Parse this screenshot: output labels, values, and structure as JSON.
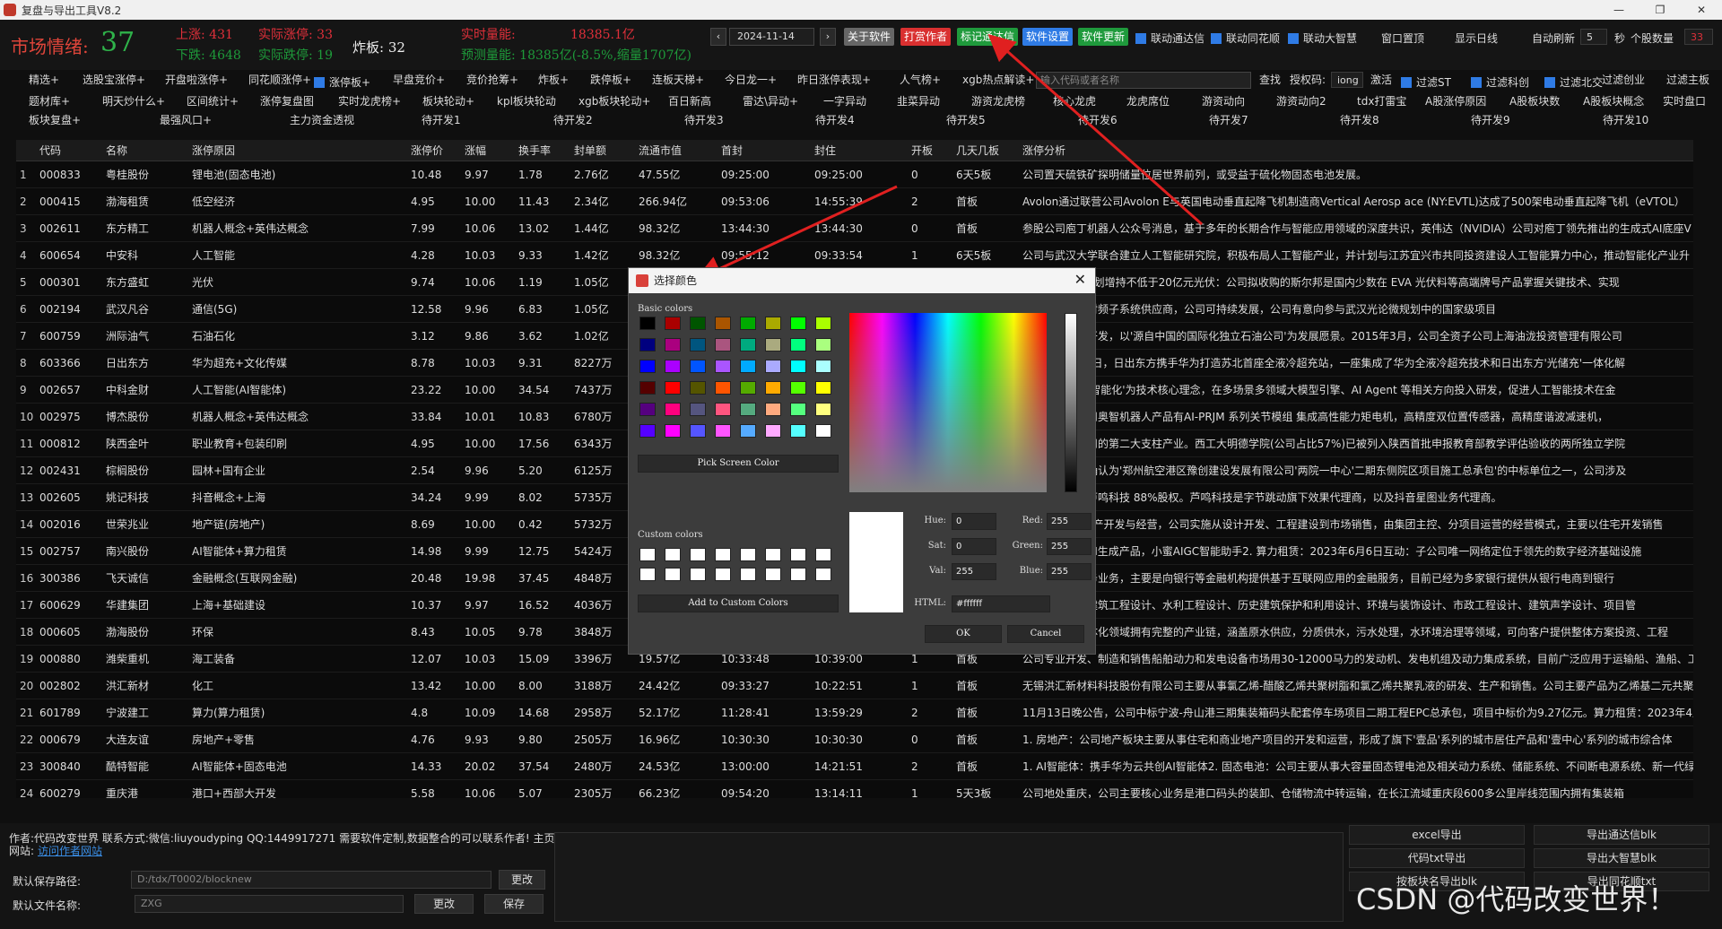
{
  "window": {
    "title": "复盘与导出工具V8.2",
    "controls": [
      "—",
      "❐",
      "✕"
    ]
  },
  "header": {
    "mood_label": "市场情绪:",
    "mood_value": "37",
    "up_limit": "上涨: 431",
    "actual_up_limit": "实际涨停: 33",
    "down_limit": "下跌: 4648",
    "actual_down_limit": "实际跌停: 19",
    "broken": "炸板: 32",
    "realtime_volume_label": "实时量能:",
    "realtime_volume_value": "18385.1亿",
    "forecast_volume": "预测量能: 18385亿(-8.5%,缩量1707亿)",
    "date_prev": "‹",
    "date": "2024-11-14",
    "date_next": "›",
    "buttons": {
      "about": "关于软件",
      "reward": "打赏作者",
      "mark_tdx": "标记通达信",
      "settings": "软件设置",
      "update": "软件更新"
    },
    "link_tdx": "联动通达信",
    "link_ths": "联动同花顺",
    "link_dzh": "联动大智慧",
    "window_top": "窗口置顶",
    "show_sun_line": "显示日线",
    "auto_refresh": "自动刷新",
    "auto_refresh_value": "5",
    "seconds": "秒",
    "stock_count_label": "个股数量",
    "stock_count": "33"
  },
  "tag_rows": {
    "row1": [
      "精选+",
      "选股宝涨停+",
      "开盘啦涨停+",
      "同花顺涨停+",
      "涨停板+",
      "早盘竞价+",
      "竞价抢筹+",
      "炸板+",
      "跌停板+",
      "连板天梯+",
      "今日龙一+",
      "昨日涨停表现+",
      "人气榜+",
      "xgb热点解读+"
    ],
    "search_placeholder": "输入代码或者名称",
    "row1_right": [
      "查找",
      "授权码:",
      "iong",
      "激活",
      "过滤ST",
      "过滤科创",
      "过滤北交",
      "过滤创业",
      "过滤主板"
    ],
    "row2": [
      "题材库+",
      "明天炒什么+",
      "区间统计+",
      "涨停复盘图",
      "实时龙虎榜+",
      "板块轮动+",
      "kpl板块轮动",
      "xgb板块轮动+",
      "百日新高",
      "雷达\\异动+",
      "一字异动",
      "韭菜异动",
      "游资龙虎榜",
      "核心龙虎",
      "龙虎席位",
      "游资动向",
      "游资动向2",
      "tdx打雷宝",
      "A股涨停原因",
      "A股板块数",
      "A股板块概念",
      "实时盘口"
    ],
    "row3": [
      "板块复盘+",
      "最强风口+",
      "主力资金透视",
      "待开发1",
      "待开发2",
      "待开发3",
      "待开发4",
      "待开发5",
      "待开发6",
      "待开发7",
      "待开发8",
      "待开发9",
      "待开发10"
    ]
  },
  "table": {
    "columns": [
      "代码",
      "名称",
      "涨停原因",
      "涨停价",
      "涨幅",
      "换手率",
      "封单额",
      "流通市值",
      "首封",
      "封住",
      "开板",
      "几天几板",
      "涨停分析"
    ],
    "rows": [
      [
        "1",
        "000833",
        "粤桂股份",
        "锂电池(固态电池)",
        "10.48",
        "9.97",
        "1.78",
        "2.76亿",
        "47.55亿",
        "09:25:00",
        "09:25:00",
        "0",
        "6天5板",
        "公司置天硫铁矿探明储量位居世界前列，或受益于硫化物固态电池发展。"
      ],
      [
        "2",
        "000415",
        "渤海租赁",
        "低空经济",
        "4.95",
        "10.00",
        "11.43",
        "2.34亿",
        "266.94亿",
        "09:53:06",
        "14:55:39",
        "2",
        "首板",
        "Avolon通过联营公司Avolon E与英国电动垂直起降飞机制造商Vertical Aerosp ace (NY:EVTL)达成了500架电动垂直起降飞机（eVTOL）"
      ],
      [
        "3",
        "002611",
        "东方精工",
        "机器人概念+英伟达概念",
        "7.99",
        "10.06",
        "13.02",
        "1.44亿",
        "98.32亿",
        "13:44:30",
        "13:44:30",
        "0",
        "首板",
        "参股公司庖丁机器人公众号消息，基于多年的长期合作与智能应用领域的深度共识，英伟达（NVIDIA）公司对庖丁领先推出的生成式AI底座V"
      ],
      [
        "4",
        "600654",
        "中安科",
        "人工智能",
        "4.28",
        "10.03",
        "9.33",
        "1.42亿",
        "98.32亿",
        "09:55:12",
        "09:33:54",
        "1",
        "6天5板",
        "公司与武汉大学联合建立人工智能研究院，积极布局人工智能产业，并计划与江苏宜兴市共同投资建设人工智能算力中心，推动智能化产业升"
      ],
      [
        "5",
        "000301",
        "东方盛虹",
        "光伏",
        "9.74",
        "10.06",
        "1.19",
        "1.05亿",
        "",
        "",
        "",
        "",
        "",
        "1、控股股东计划增持不低于20亿元光伏：公司拟收购的斯尔邦是国内少数在 EVA 光伏料等高端牌号产品掌握关键技术、实现"
      ],
      [
        "6",
        "002194",
        "武汉凡谷",
        "通信(5G)",
        "12.58",
        "9.96",
        "6.83",
        "1.05亿",
        "",
        "",
        "",
        "",
        "",
        "公司是一流的射频子系统供应商，公司可持续发展，公司有意向参与武汉光论微规划中的国家级项目"
      ],
      [
        "7",
        "600759",
        "洲际油气",
        "石油石化",
        "3.12",
        "9.86",
        "3.62",
        "1.02亿",
        "",
        "",
        "",
        "",
        "",
        "为石油勘探与开发，以'源自中国的国际化独立石油公司'为发展愿景。2015年3月，公司全资子公司上海油泷投资管理有限公司"
      ],
      [
        "8",
        "603366",
        "日出东方",
        "华为超充+文化传媒",
        "8.78",
        "10.03",
        "9.31",
        "8227万",
        "",
        "",
        "",
        "",
        "",
        "2024年11月4日，日出东方携手华为打造苏北首座全液冷超充站，一座集成了华为全液冷超充技术和日出东方'光储充'一体化解"
      ],
      [
        "9",
        "002657",
        "中科金财",
        "人工智能(AI智能体)",
        "23.22",
        "10.00",
        "34.54",
        "7437万",
        "",
        "",
        "",
        "",
        "",
        "技术研发，以'智能化'为技术核心理念，在多场景多领域大模型引擎、AI Agent 等相关方向投入研发，促进人工智能技术在金"
      ],
      [
        "10",
        "002975",
        "博杰股份",
        "机器人概念+英伟达概念",
        "33.84",
        "10.01",
        "10.83",
        "6780万",
        "",
        "",
        "",
        "",
        "",
        "博杰股份子公司奥智机器人产品有AI-PRJM 系列关节模组 集成高性能力矩电机，高精度双位置传感器，高精度谐波减速机，"
      ],
      [
        "11",
        "000812",
        "陕西金叶",
        "职业教育+包装印刷",
        "4.95",
        "10.00",
        "17.56",
        "6343万",
        "",
        "",
        "",
        "",
        "",
        "教育产业为公司的第二大支柱产业。西工大明德学院(公司占比57%)已被列入陕西首批申报教育部教学评估验收的两所独立学院"
      ],
      [
        "12",
        "002431",
        "棕榈股份",
        "园林+国有企业",
        "2.54",
        "9.96",
        "5.20",
        "6125万",
        "",
        "",
        "",
        "",
        "",
        "近日，公司被确认为'郑州航空港区豫创建设发展有限公司'两院一中心'二期东侧院区项目施工总承包'的中标单位之一，公司涉及"
      ],
      [
        "13",
        "002605",
        "姚记科技",
        "抖音概念+上海",
        "34.24",
        "9.99",
        "8.02",
        "5735万",
        "",
        "",
        "",
        "",
        "",
        "公司参股公司芦鸣科技 88%股权。芦鸣科技是字节跳动旗下效果代理商，以及抖音星图业务代理商。"
      ],
      [
        "14",
        "002016",
        "世荣兆业",
        "地产链(房地产)",
        "8.69",
        "10.00",
        "0.42",
        "5732万",
        "",
        "",
        "",
        "",
        "",
        "2023年为房地产开发与经营，公司实施从设计开发、工程建设到市场销售，由集团主控、分项目运营的经营模式，主要以住宅开发销售"
      ],
      [
        "15",
        "002757",
        "南兴股份",
        "AI智能体+算力租赁",
        "14.98",
        "9.99",
        "12.75",
        "5424万",
        "",
        "",
        "",
        "",
        "",
        "智能化研究的AI生成产品，小蜜AIGC智能助手2. 算力租赁：2023年6月6日互动：子公司唯一网络定位于领先的数字经济基础设施"
      ],
      [
        "16",
        "300386",
        "飞天诚信",
        "金融概念(互联网金融)",
        "20.48",
        "19.98",
        "37.45",
        "4848万",
        "",
        "",
        "",
        "",
        "",
        "要开展金融服务业务，主要是向银行等金融机构提供基于互联网应用的金融服务，目前已经为多家银行提供从银行电商到银行"
      ],
      [
        "17",
        "600629",
        "华建集团",
        "上海+基础建设",
        "10.37",
        "9.97",
        "16.52",
        "4036万",
        "",
        "",
        "",
        "",
        "",
        "公司主要从事建筑工程设计、水利工程设计、历史建筑保护和利用设计、环境与装饰设计、市政工程设计、建筑声学设计、项目管"
      ],
      [
        "18",
        "000605",
        "渤海股份",
        "环保",
        "8.43",
        "10.05",
        "9.78",
        "3848万",
        "",
        "",
        "",
        "",
        "",
        "公司在水务一体化领域拥有完整的产业链，涵盖原水供应，分质供水，污水处理，水环境治理等领域，可向客户提供整体方案投资、工程"
      ],
      [
        "19",
        "000880",
        "潍柴重机",
        "海工装备",
        "12.07",
        "10.03",
        "15.09",
        "3396万",
        "19.57亿",
        "10:33:48",
        "10:39:00",
        "1",
        "首板",
        "公司专业开发、制造和销售船舶动力和发电设备市场用30-12000马力的发动机、发电机组及动力集成系统，目前广泛应用于运输船、渔船、工"
      ],
      [
        "20",
        "002802",
        "洪汇新材",
        "化工",
        "13.42",
        "10.00",
        "8.00",
        "3188万",
        "24.42亿",
        "09:33:27",
        "10:22:51",
        "1",
        "首板",
        "无锡洪汇新材料科技股份有限公司主要从事氯乙烯-醋酸乙烯共聚树脂和氯乙烯共聚乳液的研发、生产和销售。公司主要产品为乙烯基二元共聚"
      ],
      [
        "21",
        "601789",
        "宁波建工",
        "算力(算力租赁)",
        "4.8",
        "10.09",
        "14.68",
        "2958万",
        "52.17亿",
        "11:28:41",
        "13:59:29",
        "2",
        "首板",
        "11月13日晚公告，公司中标宁波-舟山港三期集装箱码头配套停车场项目二期工程EPC总承包，项目中标价为9.27亿元。算力租赁：2023年4月"
      ],
      [
        "22",
        "000679",
        "大连友谊",
        "房地产+零售",
        "4.76",
        "9.93",
        "9.80",
        "2505万",
        "16.96亿",
        "10:30:30",
        "10:30:30",
        "0",
        "首板",
        "1. 房地产：公司地产板块主要从事住宅和商业地产项目的开发和运营，形成了旗下'壹品'系列的城市居住产品和'壹中心'系列的城市综合体"
      ],
      [
        "23",
        "300840",
        "酷特智能",
        "AI智能体+固态电池",
        "14.33",
        "20.02",
        "37.54",
        "2480万",
        "24.53亿",
        "13:00:00",
        "14:21:51",
        "2",
        "首板",
        "1. AI智能体：携手华为云共创AI智能体2. 固态电池：公司主要从事大容量固态锂电池及相关动力系统、储能系统、不间断电源系统、新一代绿"
      ],
      [
        "24",
        "600279",
        "重庆港",
        "港口+西部大开发",
        "5.58",
        "10.06",
        "5.07",
        "2305万",
        "66.23亿",
        "09:54:20",
        "13:14:11",
        "1",
        "5天3板",
        "公司地处重庆，公司主要核心业务是港口码头的装卸、仓储物流中转运输，在长江流域重庆段600多公里岸线范围内拥有集装箱"
      ]
    ]
  },
  "dialog": {
    "title": "选择颜色",
    "close": "✕",
    "basic_colors_label": "Basic colors",
    "basic_colors": [
      [
        "#000000",
        "#aa0000",
        "#005500",
        "#aa5500",
        "#00aa00",
        "#aaaa00",
        "#00ff00",
        "#aaff00"
      ],
      [
        "#00007f",
        "#aa007f",
        "#00557f",
        "#aa557f",
        "#00aa7f",
        "#aaaa7f",
        "#00ff7f",
        "#aaff7f"
      ],
      [
        "#0000ff",
        "#aa00ff",
        "#0055ff",
        "#aa55ff",
        "#00aaff",
        "#aaaaff",
        "#00ffff",
        "#aaffff"
      ],
      [
        "#550000",
        "#ff0000",
        "#555500",
        "#ff5500",
        "#55aa00",
        "#ffaa00",
        "#55ff00",
        "#ffff00"
      ],
      [
        "#55007f",
        "#ff007f",
        "#55557f",
        "#ff557f",
        "#55aa7f",
        "#ffaa7f",
        "#55ff7f",
        "#ffff7f"
      ],
      [
        "#5500ff",
        "#ff00ff",
        "#5555ff",
        "#ff55ff",
        "#55aaff",
        "#ffaaff",
        "#55ffff",
        "#ffffff"
      ]
    ],
    "pick_screen_color": "Pick Screen Color",
    "custom_colors_label": "Custom colors",
    "add_custom_colors": "Add to Custom Colors",
    "hue_label": "Hue:",
    "hue": "0",
    "sat_label": "Sat:",
    "sat": "0",
    "val_label": "Val:",
    "val": "255",
    "red_label": "Red:",
    "red": "255",
    "green_label": "Green:",
    "green": "255",
    "blue_label": "Blue:",
    "blue": "255",
    "html_label": "HTML:",
    "html": "#ffffff",
    "ok": "OK",
    "cancel": "Cancel",
    "selected_color": "#ffffff"
  },
  "bottom": {
    "author_line": "作者:代码改变世界 联系方式:微信:liuyoudyping QQ:1449917271 需要软件定制,数据整合的可以联系作者! 主页",
    "website_label": "网站:",
    "website_link": "访问作者网站",
    "save_path_label": "默认保存路径:",
    "save_path": "D:/tdx/T0002/blocknew",
    "change_path_button": "更改",
    "file_name_label": "默认文件名称:",
    "file_name": "ZXG",
    "change_name_button": "更改",
    "save_button": "保存",
    "export_buttons": {
      "excel": "excel导出",
      "tdx_blk": "导出通达信blk",
      "code_txt": "代码txt导出",
      "dzh_blk": "导出大智慧blk",
      "plate_blk": "按板块名导出blk",
      "ths_txt": "导出同花顺txt"
    },
    "watermark": "CSDN @代码改变世界！"
  }
}
